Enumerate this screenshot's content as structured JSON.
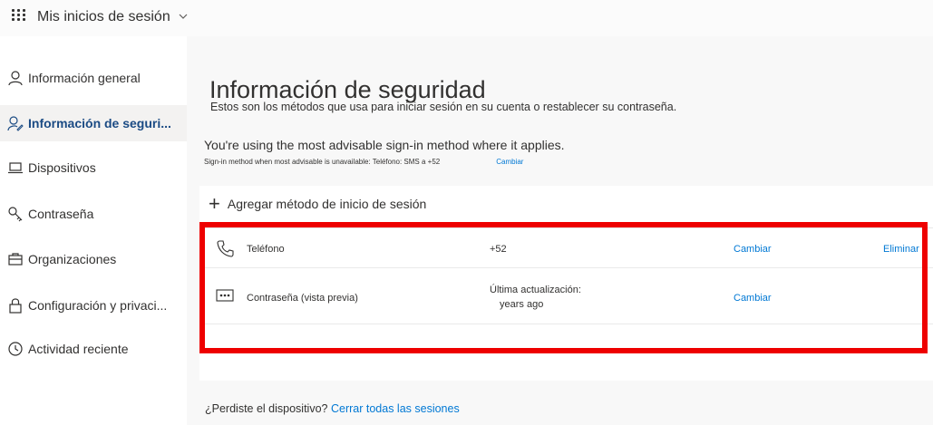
{
  "header": {
    "title": "Mis inicios de sesión",
    "app_launcher_icon": "waffle-icon",
    "dropdown_icon": "chevron-down-icon"
  },
  "sidebar": {
    "items": [
      {
        "label": "Información general",
        "icon": "person-icon",
        "active": false
      },
      {
        "label": "Información de seguri...",
        "icon": "security-info-icon",
        "active": true
      },
      {
        "label": "Dispositivos",
        "icon": "laptop-icon",
        "active": false
      },
      {
        "label": "Contraseña",
        "icon": "key-icon",
        "active": false
      },
      {
        "label": "Organizaciones",
        "icon": "briefcase-icon",
        "active": false
      },
      {
        "label": "Configuración y privaci...",
        "icon": "lock-icon",
        "active": false
      },
      {
        "label": "Actividad reciente",
        "icon": "history-icon",
        "active": false
      }
    ]
  },
  "main": {
    "title": "Información de seguridad",
    "subtitle": "Estos son los métodos que usa para iniciar sesión en su cuenta o restablecer su contraseña.",
    "advisable": "You're using the most advisable sign-in method where it applies.",
    "advisable_detail": "Sign-in method when most advisable is unavailable: Teléfono: SMS a +52",
    "advisable_change": "Cambiar",
    "add_method": "Agregar método de inicio de sesión",
    "methods": [
      {
        "icon": "phone-icon",
        "name": "Teléfono",
        "value": "+52",
        "value2": "",
        "change": "Cambiar",
        "delete": "Eliminar"
      },
      {
        "icon": "password-icon",
        "name": "Contraseña (vista previa)",
        "value": "Última actualización:",
        "value2": "years ago",
        "change": "Cambiar",
        "delete": ""
      }
    ],
    "footer_question": "¿Perdiste el dispositivo?",
    "footer_link": "Cerrar todas las sesiones"
  },
  "colors": {
    "accent": "#0078d4",
    "highlight": "#ee0000",
    "active_nav_text": "#1b4b84"
  }
}
